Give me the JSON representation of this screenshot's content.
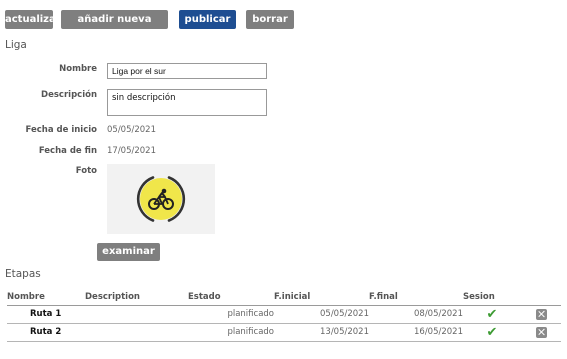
{
  "toolbar": {
    "refresh_label": "actualizar",
    "add_stage_label": "añadir nueva etapa",
    "publish_label": "publicar",
    "delete_label": "borrar"
  },
  "league": {
    "section_title": "Liga",
    "name_label": "Nombre",
    "name_value": "Liga por el sur",
    "description_label": "Descripción",
    "description_value": "sin descripción",
    "start_date_label": "Fecha de inicio",
    "start_date_value": "05/05/2021",
    "end_date_label": "Fecha de fin",
    "end_date_value": "17/05/2021",
    "photo_label": "Foto",
    "browse_label": "examinar",
    "colors": {
      "logo_yellow": "#f0e64a",
      "logo_dark": "#333333"
    }
  },
  "stages": {
    "section_title": "Etapas",
    "columns": [
      "Nombre",
      "Description",
      "Estado",
      "F.inicial",
      "F.final",
      "Sesion"
    ],
    "rows": [
      {
        "name": "Ruta 1",
        "description": "",
        "status": "planificado",
        "start": "05/05/2021",
        "end": "08/05/2021"
      },
      {
        "name": "Ruta 2",
        "description": "",
        "status": "planificado",
        "start": "13/05/2021",
        "end": "16/05/2021"
      }
    ]
  },
  "colors": {
    "gray_button": "#7f7f7f",
    "blue_button": "#1e4e92",
    "check_green": "#3d9b33"
  }
}
